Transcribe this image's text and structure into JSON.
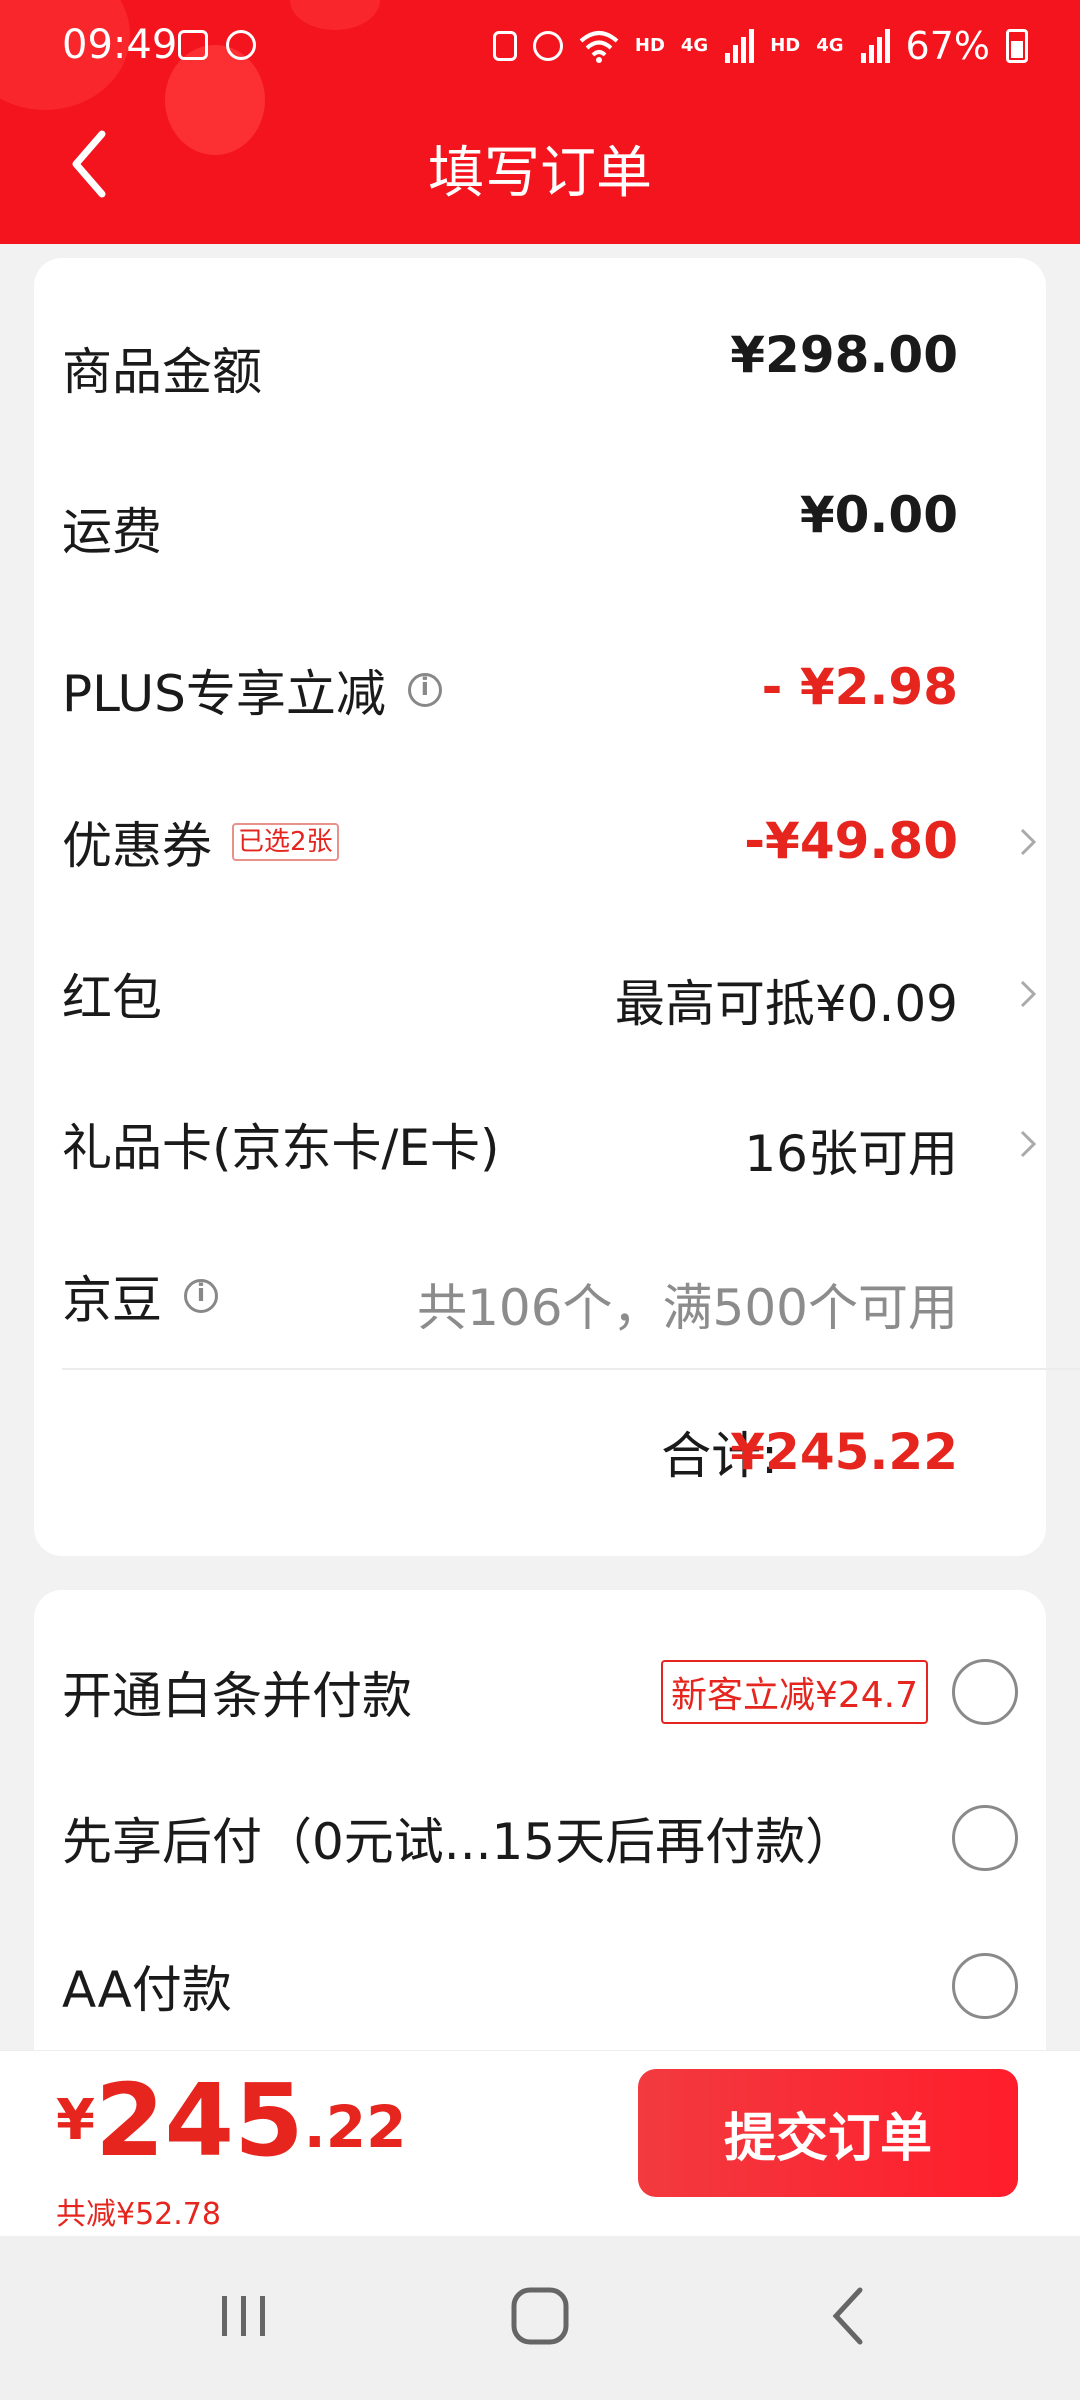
{
  "status_bar": {
    "time": "09:49",
    "network_hd1": "HD",
    "network_4g1": "4G",
    "network_hd2": "HD",
    "network_4g2": "4G",
    "battery": "67%"
  },
  "header": {
    "title": "填写订单"
  },
  "summary": {
    "goods_amount": {
      "label": "商品金额",
      "value": "¥298.00"
    },
    "shipping": {
      "label": "运费",
      "value": "¥0.00"
    },
    "plus_discount": {
      "label": "PLUS专享立减",
      "value": "- ¥2.98"
    },
    "coupon": {
      "label": "优惠券",
      "tag": "已选2张",
      "value": "-¥49.80"
    },
    "red_packet": {
      "label": "红包",
      "value": "最高可抵¥0.09"
    },
    "gift_card": {
      "label": "礼品卡(京东卡/E卡)",
      "value": "16张可用"
    },
    "jingdou": {
      "label": "京豆",
      "value": "共106个，满500个可用"
    },
    "total_label": "合计:",
    "total_value": "¥245.22"
  },
  "payment": {
    "options": [
      {
        "label": "开通白条并付款",
        "promo": "新客立减¥24.7"
      },
      {
        "label": "先享后付（0元试...15天后再付款）"
      },
      {
        "label": "AA付款"
      }
    ]
  },
  "checkout": {
    "currency": "¥",
    "price_int": "245",
    "price_dec": ".22",
    "saved": "共减¥52.78",
    "submit": "提交订单"
  },
  "colors": {
    "brand_red": "#f3141e",
    "price_red": "#e5251e"
  }
}
